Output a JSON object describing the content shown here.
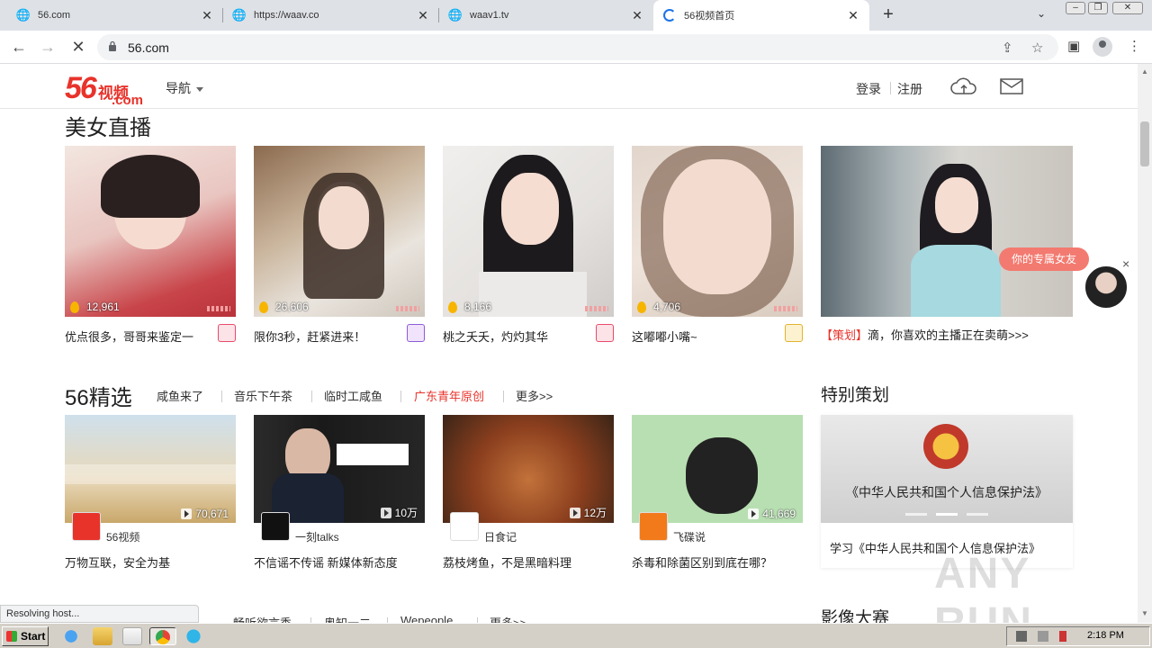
{
  "browser": {
    "tabs": [
      {
        "title": "56.com",
        "active": false
      },
      {
        "title": "https://waav.co",
        "active": false
      },
      {
        "title": "waav1.tv",
        "active": false
      },
      {
        "title": "56视频首页",
        "active": true
      }
    ],
    "url": "56.com",
    "status": "Resolving host..."
  },
  "site": {
    "logo_num": "56",
    "logo_cn": "视频",
    "logo_com": ".com",
    "nav_label": "导航",
    "login": "登录",
    "register": "注册"
  },
  "live": {
    "title": "美女直播",
    "cards": [
      {
        "views": "12,961",
        "caption": "优点很多，哥哥来鉴定一",
        "badge_color": "#e94b6a"
      },
      {
        "views": "26,606",
        "caption": "限你3秒，赶紧进来！",
        "badge_color": "#8e5bd6"
      },
      {
        "views": "8,166",
        "caption": "桃之夭夭，灼灼其华",
        "badge_color": "#e94b6a"
      },
      {
        "views": "4,706",
        "caption": "这嘟嘟小嘴~",
        "badge_color": "#e3b22f"
      }
    ],
    "promo_tag": "【策划】",
    "promo_text": "滴，你喜欢的主播正在卖萌>>>",
    "float_button": "你的专属女友",
    "float_close": "×"
  },
  "featured": {
    "title": "56精选",
    "tabs": [
      "咸鱼来了",
      "音乐下午茶",
      "临时工咸鱼",
      "广东青年原创",
      "更多>>"
    ],
    "active_tab_color": "#e8332b",
    "videos": [
      {
        "count": "70,671",
        "channel": "56视频",
        "title": "万物互联，安全为基"
      },
      {
        "count": "10万",
        "channel": "一刻talks",
        "title": "不信谣不传谣 新媒体新态度"
      },
      {
        "count": "12万",
        "channel": "日食记",
        "title": "荔枝烤鱼，不是黑暗料理"
      },
      {
        "count": "41,669",
        "channel": "飞碟说",
        "title": "杀毒和除菌区别到底在哪？"
      }
    ]
  },
  "special": {
    "heading": "特别策划",
    "image_text": "《中华人民共和国个人信息保护法》",
    "caption": "学习《中华人民共和国个人信息保护法》"
  },
  "bottom": {
    "tabs": [
      "畅听欲言秀",
      "奥知一二",
      "Wepeople",
      "更多>>"
    ],
    "right_heading": "影像大赛"
  },
  "watermark": "ANY RUN",
  "taskbar": {
    "start": "Start",
    "time": "2:18 PM"
  }
}
